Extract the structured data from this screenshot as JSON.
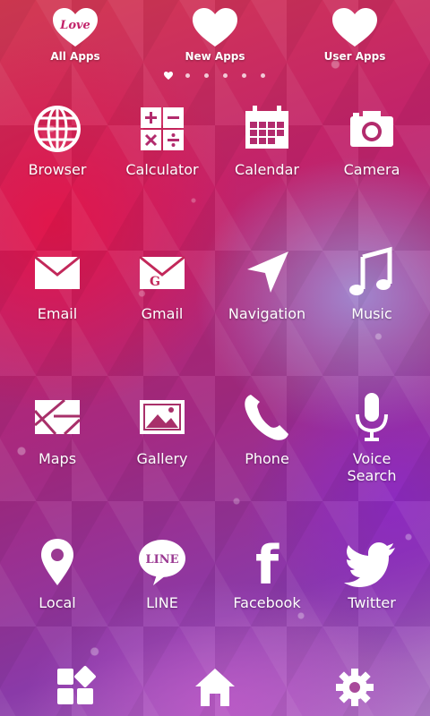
{
  "topbar": {
    "all_apps": {
      "label": "All Apps",
      "badge": "Love"
    },
    "new_apps": {
      "label": "New Apps"
    },
    "user_apps": {
      "label": "User Apps"
    },
    "pages": 6,
    "current_page": 1
  },
  "apps": [
    {
      "label": "Browser",
      "icon": "globe-icon"
    },
    {
      "label": "Calculator",
      "icon": "calculator-icon"
    },
    {
      "label": "Calendar",
      "icon": "calendar-icon"
    },
    {
      "label": "Camera",
      "icon": "camera-icon"
    },
    {
      "label": "Email",
      "icon": "envelope-icon"
    },
    {
      "label": "Gmail",
      "icon": "gmail-envelope-icon",
      "glyph": "G"
    },
    {
      "label": "Navigation",
      "icon": "navigation-arrow-icon"
    },
    {
      "label": "Music",
      "icon": "music-note-icon"
    },
    {
      "label": "Maps",
      "icon": "map-icon"
    },
    {
      "label": "Gallery",
      "icon": "picture-icon"
    },
    {
      "label": "Phone",
      "icon": "phone-handset-icon"
    },
    {
      "label": "Voice\nSearch",
      "icon": "microphone-icon"
    },
    {
      "label": "Local",
      "icon": "location-pin-icon"
    },
    {
      "label": "LINE",
      "icon": "line-bubble-icon",
      "glyph": "LINE"
    },
    {
      "label": "Facebook",
      "icon": "facebook-f-icon",
      "glyph": "f"
    },
    {
      "label": "Twitter",
      "icon": "twitter-bird-icon"
    }
  ],
  "dock": {
    "widgets": "widgets-icon",
    "home": "home-icon",
    "settings": "gear-icon"
  },
  "colors": {
    "icon": "#ffffff",
    "background_primary": "#c2236a",
    "background_secondary": "#8a3aa8"
  }
}
